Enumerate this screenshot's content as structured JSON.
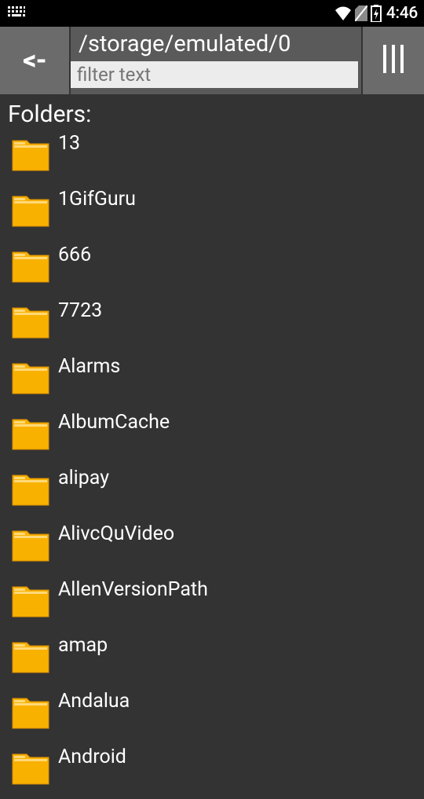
{
  "status": {
    "time": "4:46"
  },
  "appbar": {
    "back_label": "<-",
    "path": "/storage/emulated/0",
    "filter_placeholder": "filter text"
  },
  "section": {
    "title": "Folders:"
  },
  "folders": [
    {
      "name": "13"
    },
    {
      "name": "1GifGuru"
    },
    {
      "name": "666"
    },
    {
      "name": "7723"
    },
    {
      "name": "Alarms"
    },
    {
      "name": "AlbumCache"
    },
    {
      "name": "alipay"
    },
    {
      "name": "AlivcQuVideo"
    },
    {
      "name": "AllenVersionPath"
    },
    {
      "name": "amap"
    },
    {
      "name": "Andalua"
    },
    {
      "name": "Android"
    }
  ],
  "colors": {
    "folder_fill": "#f9b100",
    "folder_stroke": "#d98f00",
    "folder_tab": "#ffd978"
  }
}
